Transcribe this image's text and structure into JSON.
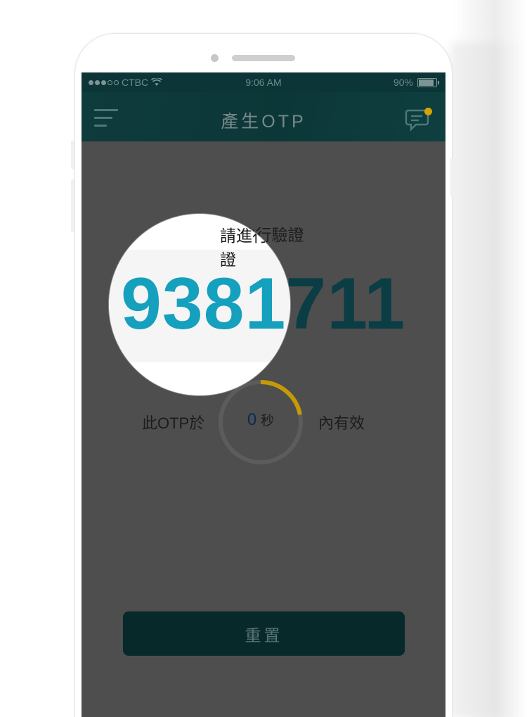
{
  "status_bar": {
    "carrier": "CTBC",
    "time": "9:06 AM",
    "battery_percent": "90%"
  },
  "header": {
    "title": "產生OTP"
  },
  "main": {
    "prompt": "請進行驗證",
    "otp": "9381711",
    "otp_magnified": "9381",
    "otp_rest": "711",
    "timer": {
      "prefix": "此OTP於",
      "value": "0",
      "unit": "秒",
      "suffix": "內有效",
      "progress_fraction": 0.22
    },
    "reset_label": "重置"
  },
  "colors": {
    "otp_highlight": "#15a0bd",
    "otp_dimmed": "#0b3d44",
    "timer_arc": "#c59a05",
    "notification_dot": "#d6a400"
  },
  "icons": [
    "menu-icon",
    "message-icon",
    "wifi-icon",
    "battery-icon"
  ]
}
